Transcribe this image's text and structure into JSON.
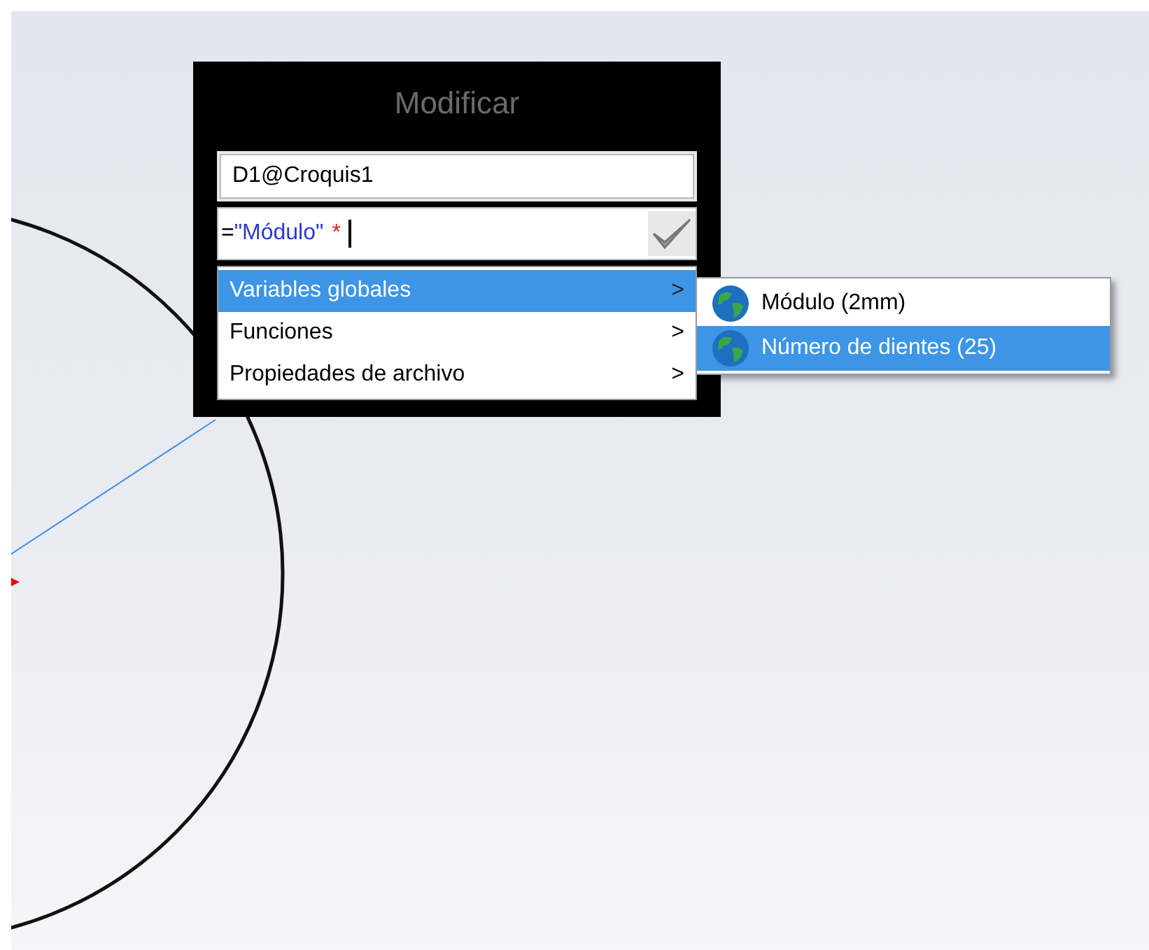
{
  "dialog": {
    "title": "Modificar",
    "name_field": {
      "value": "D1@Croquis1"
    },
    "equation": [
      {
        "kind": "plain",
        "text": "="
      },
      {
        "kind": "variable",
        "text": "\"Módulo\""
      },
      {
        "kind": "operator",
        "text": "*"
      }
    ],
    "menu": [
      {
        "label": "Variables globales",
        "arrow": ">",
        "selected": true
      },
      {
        "label": "Funciones",
        "arrow": ">",
        "selected": false
      },
      {
        "label": "Propiedades de archivo",
        "arrow": ">",
        "selected": false
      }
    ],
    "submenu": [
      {
        "label": "Módulo (2mm)",
        "selected": false
      },
      {
        "label": "Número de dientes (25)",
        "selected": true
      }
    ]
  }
}
